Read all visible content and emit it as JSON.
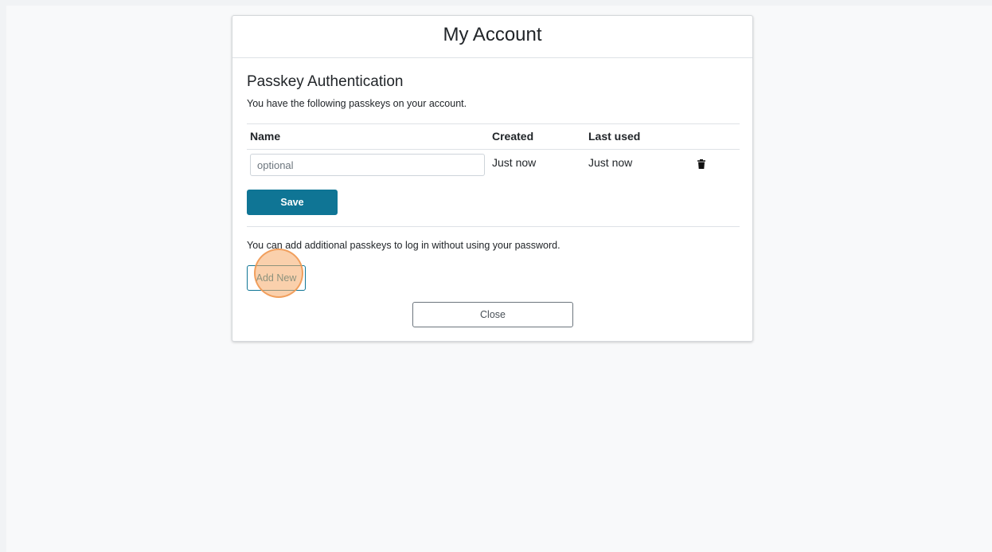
{
  "header": {
    "title": "My Account"
  },
  "passkeys": {
    "section_title": "Passkey Authentication",
    "description": "You have the following passkeys on your account.",
    "columns": {
      "name": "Name",
      "created": "Created",
      "last_used": "Last used"
    },
    "rows": [
      {
        "name_value": "",
        "name_placeholder": "optional",
        "created": "Just now",
        "last_used": "Just now",
        "delete_icon": "trash-icon"
      }
    ],
    "save_label": "Save",
    "add_description": "You can add additional passkeys to log in without using your password.",
    "add_label": "Add New"
  },
  "footer": {
    "close_label": "Close"
  },
  "colors": {
    "primary": "#0f7595",
    "click_highlight": "#f6aa68"
  }
}
